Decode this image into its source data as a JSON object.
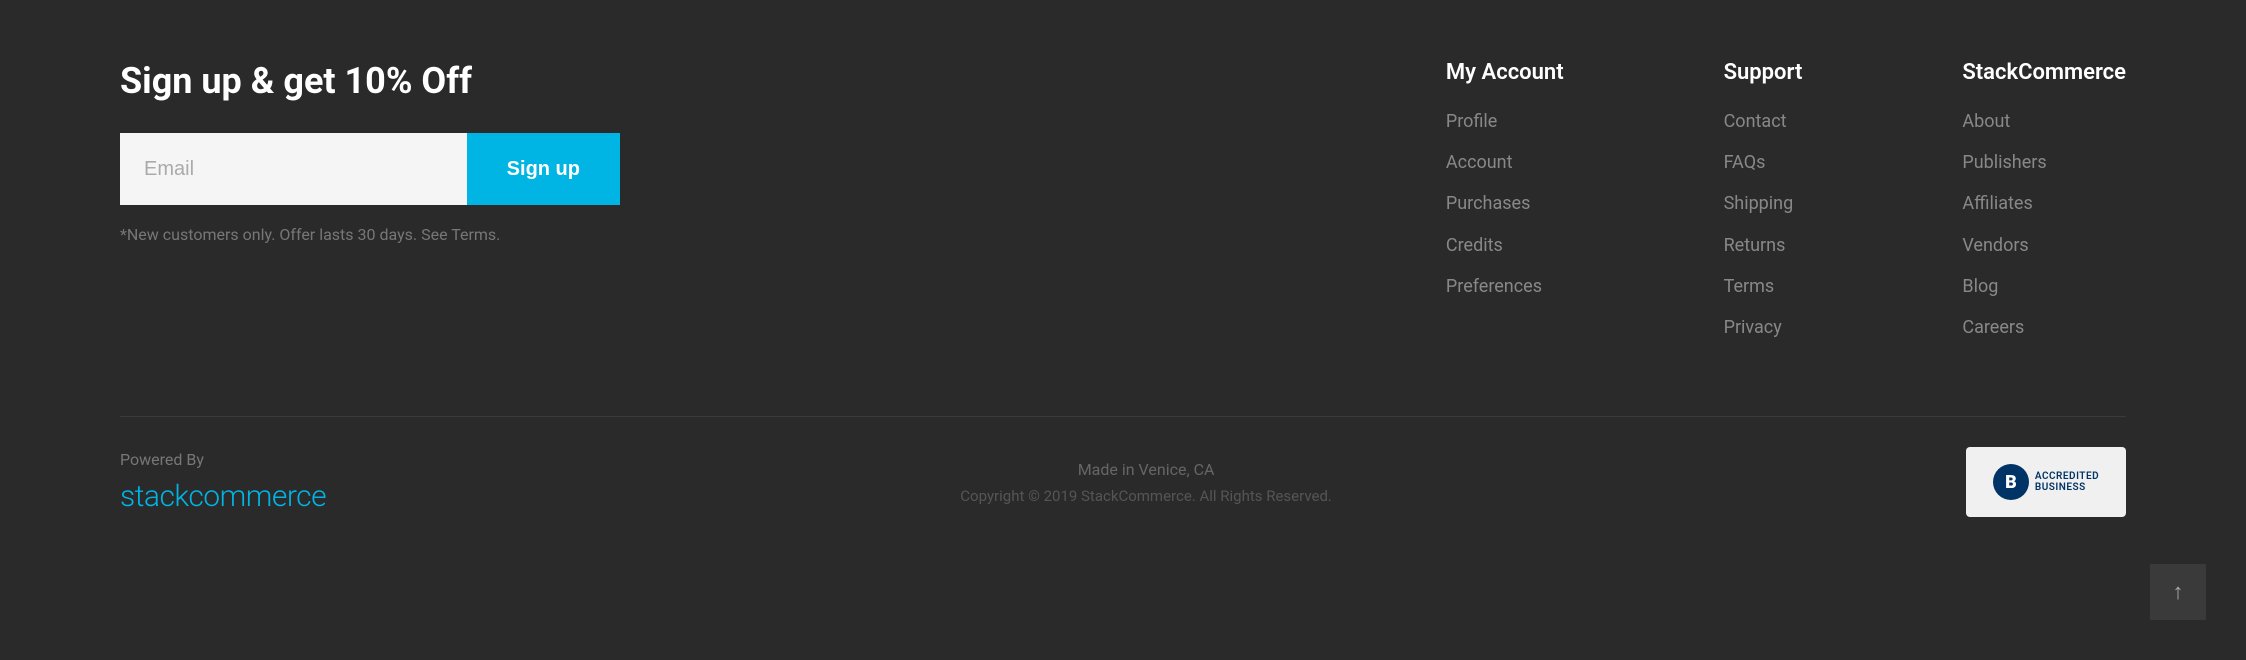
{
  "signup": {
    "title": "Sign up & get 10% Off",
    "email_placeholder": "Email",
    "button_label": "Sign up",
    "note": "*New customers only. Offer lasts 30 days. See Terms."
  },
  "my_account": {
    "heading": "My Account",
    "links": [
      {
        "label": "Profile"
      },
      {
        "label": "Account"
      },
      {
        "label": "Purchases"
      },
      {
        "label": "Credits"
      },
      {
        "label": "Preferences"
      }
    ]
  },
  "support": {
    "heading": "Support",
    "links": [
      {
        "label": "Contact"
      },
      {
        "label": "FAQs"
      },
      {
        "label": "Shipping"
      },
      {
        "label": "Returns"
      },
      {
        "label": "Terms"
      },
      {
        "label": "Privacy"
      }
    ]
  },
  "stackcommerce": {
    "heading": "StackCommerce",
    "links": [
      {
        "label": "About"
      },
      {
        "label": "Publishers"
      },
      {
        "label": "Affiliates"
      },
      {
        "label": "Vendors"
      },
      {
        "label": "Blog"
      },
      {
        "label": "Careers"
      }
    ]
  },
  "footer": {
    "powered_by": "Powered By",
    "logo_text": "stackcommerce",
    "made_in": "Made in Venice, CA",
    "copyright": "Copyright © 2019 StackCommerce. All Rights Reserved."
  },
  "scroll_top": "↑"
}
